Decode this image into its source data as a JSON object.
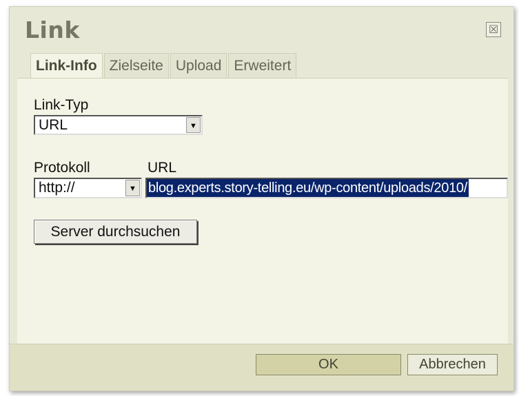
{
  "dialog": {
    "title": "Link",
    "close_icon_glyph": "☒"
  },
  "tabs": [
    {
      "label": "Link-Info",
      "active": true
    },
    {
      "label": "Zielseite",
      "active": false
    },
    {
      "label": "Upload",
      "active": false
    },
    {
      "label": "Erweitert",
      "active": false
    }
  ],
  "form": {
    "link_type_label": "Link-Typ",
    "link_type_value": "URL",
    "protocol_label": "Protokoll",
    "protocol_value": "http://",
    "url_label": "URL",
    "url_value": "blog.experts.story-telling.eu/wp-content/uploads/2010/",
    "browse_server_label": "Server durchsuchen"
  },
  "footer": {
    "ok_label": "OK",
    "cancel_label": "Abbrechen"
  },
  "icons": {
    "close": "close-icon",
    "dropdown": "chevron-down-icon"
  },
  "colors": {
    "dialog_bg": "#e8e8d6",
    "panel_bg": "#f4f4e6",
    "title_text": "#777766",
    "selection_bg": "#0a246a"
  }
}
